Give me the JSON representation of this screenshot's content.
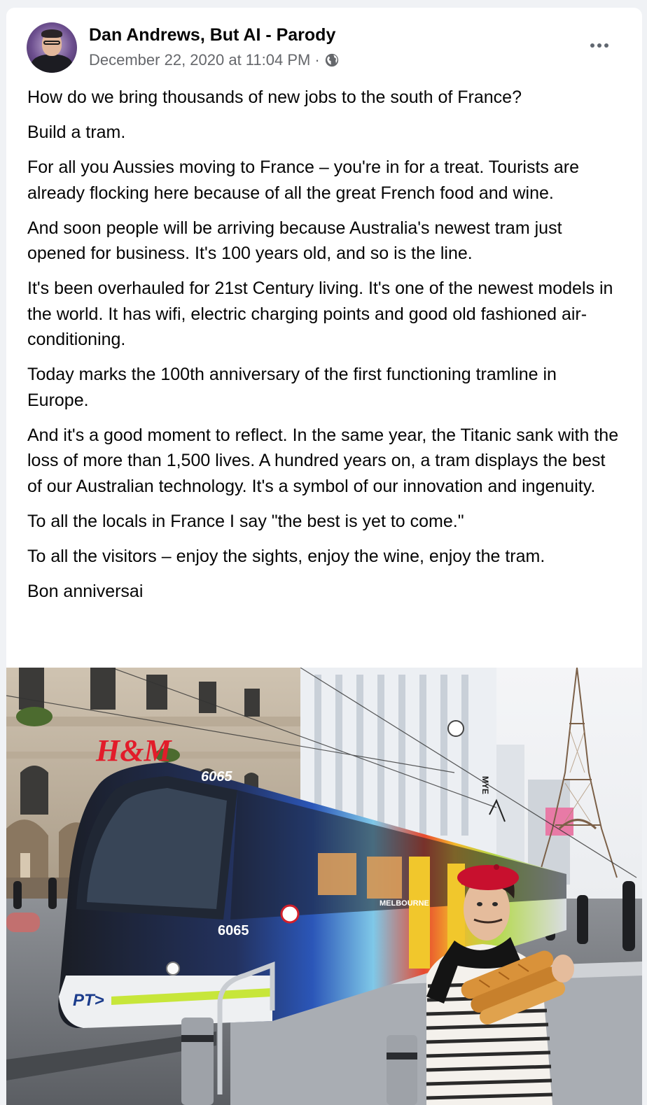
{
  "post": {
    "author": "Dan Andrews, But AI - Parody",
    "timestamp": "December 22, 2020 at 11:04 PM",
    "separator": "·",
    "privacy_icon": "globe-icon",
    "more_icon": "more-options-icon",
    "paragraphs": [
      "How do we bring thousands of new jobs to the south of France?",
      "Build a tram.",
      "For all you Aussies moving to France – you're in for a treat. Tourists are already flocking here because of all the great French food and wine.",
      "And soon people will be arriving because Australia's newest tram just opened for business. It's 100 years old, and so is the line.",
      "It's been overhauled for 21st Century living. It's one of the newest models in the world. It has wifi, electric charging points and good old fashioned air-conditioning.",
      "Today marks the 100th anniversary of the first functioning tramline in Europe.",
      "And it's a good moment to reflect. In the same year, the Titanic sank with the loss of more than 1,500 lives. A hundred years on, a tram displays the best of our Australian technology. It's a symbol of our innovation and ingenuity.",
      "To all the locals in France I say \"the best is yet to come.\"",
      "To all the visitors – enjoy the sights, enjoy the wine, enjoy the tram.",
      "Bon anniversai"
    ]
  },
  "photo": {
    "tram_number": "6065",
    "store_sign": "H&M",
    "tram_brand": "PT>",
    "dept_sign": "MYE",
    "dest_sign": "MELBOURNE"
  },
  "colors": {
    "text": "#050505",
    "secondary": "#65676b",
    "background": "#f0f2f5",
    "card": "#ffffff"
  }
}
